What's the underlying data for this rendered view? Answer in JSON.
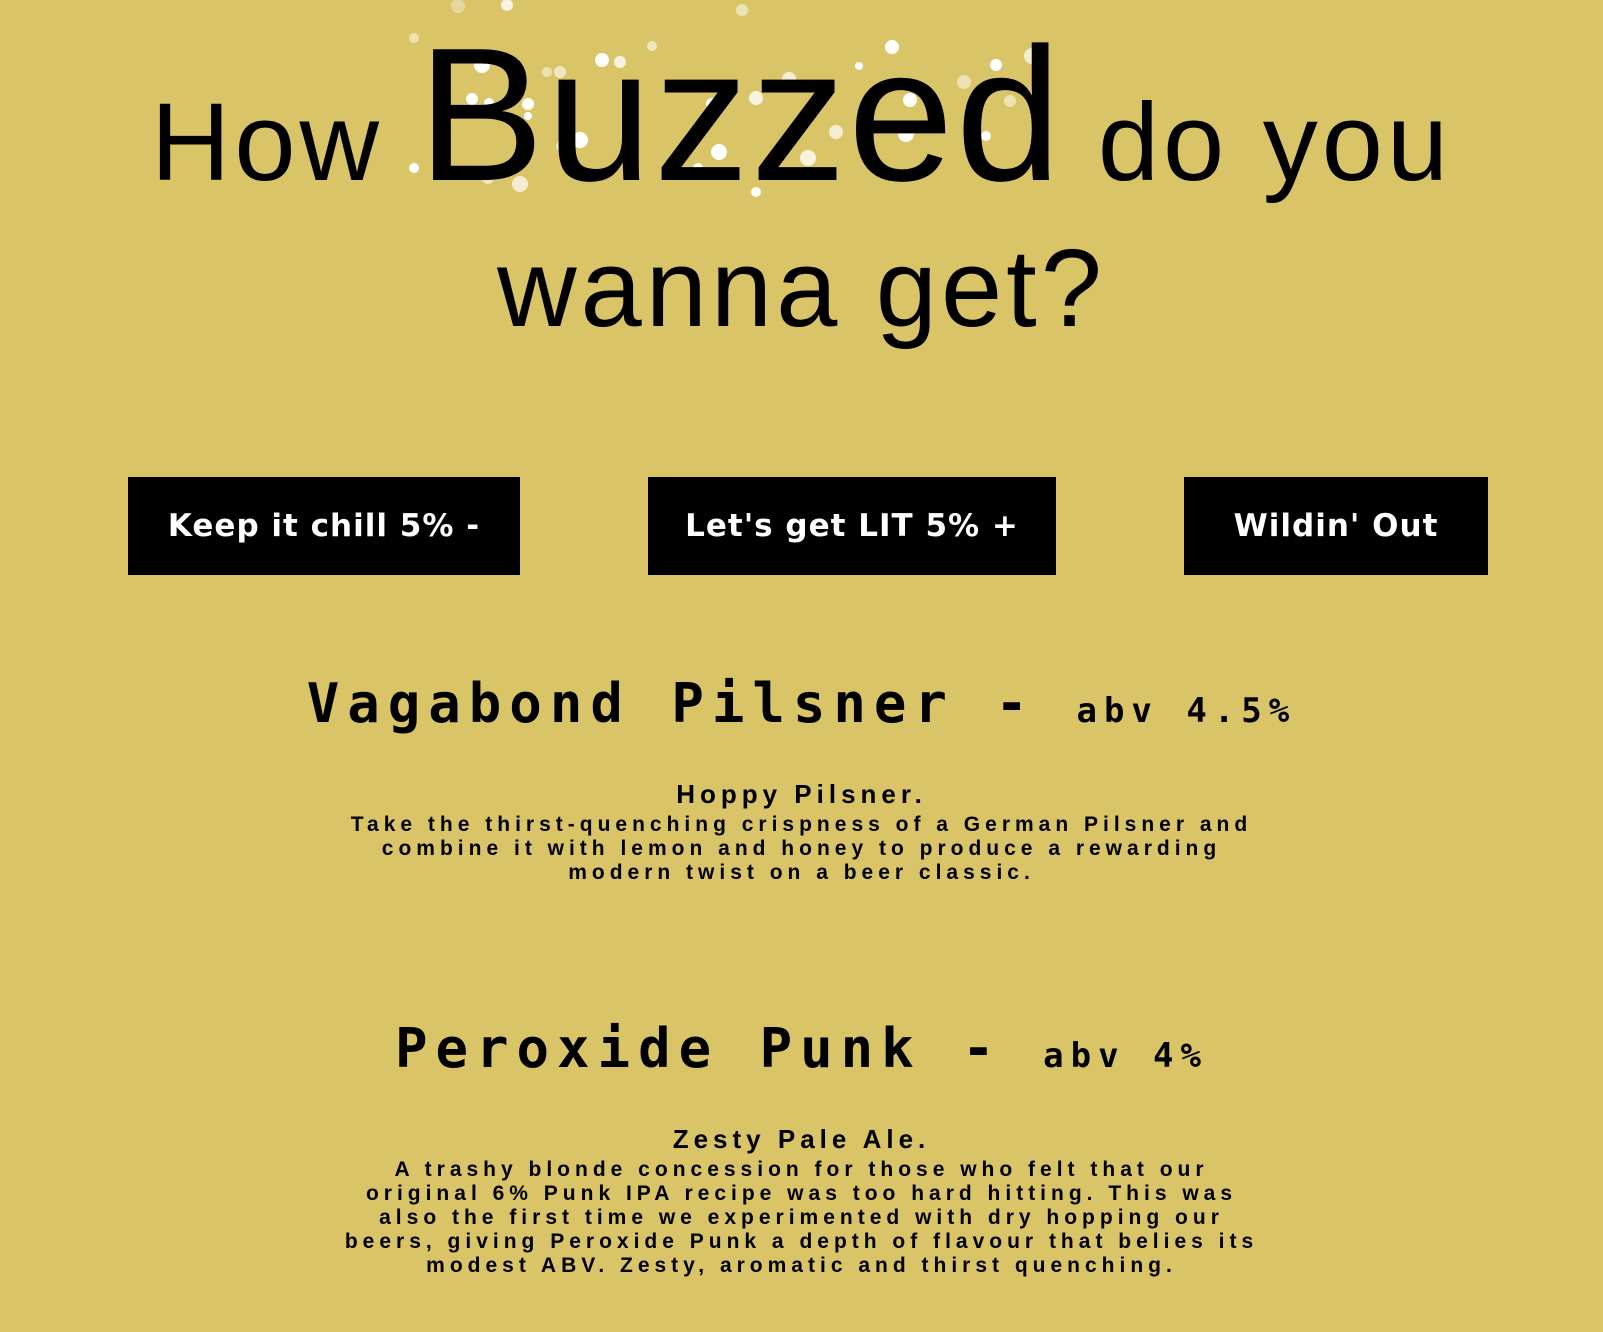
{
  "hero": {
    "prefix": "How",
    "highlight": "Buzzed",
    "suffix": "do you",
    "line2": "wanna get?"
  },
  "filters": [
    {
      "label": "Keep it chill 5% -"
    },
    {
      "label": "Let's get LIT 5% +"
    },
    {
      "label": "Wildin' Out"
    }
  ],
  "beers": [
    {
      "name": "Vagabond Pilsner - ",
      "abv": "abv 4.5%",
      "tagline": "Hoppy Pilsner.",
      "description": "Take the thirst-quenching crispness of a German Pilsner and combine it with lemon and honey to produce a rewarding modern twist on a beer classic."
    },
    {
      "name": "Peroxide Punk - ",
      "abv": "abv 4%",
      "tagline": "Zesty Pale Ale.",
      "description": "A trashy blonde concession for those who felt that our original 6% Punk IPA recipe was too hard hitting. This was also the first time we experimented with dry hopping our beers, giving Peroxide Punk a depth of flavour that belies its modest ABV. Zesty, aromatic and thirst quenching."
    }
  ],
  "colors": {
    "background": "#d9c468",
    "button_bg": "#000000",
    "button_text": "#ffffff",
    "bubble": "#ffffff"
  }
}
